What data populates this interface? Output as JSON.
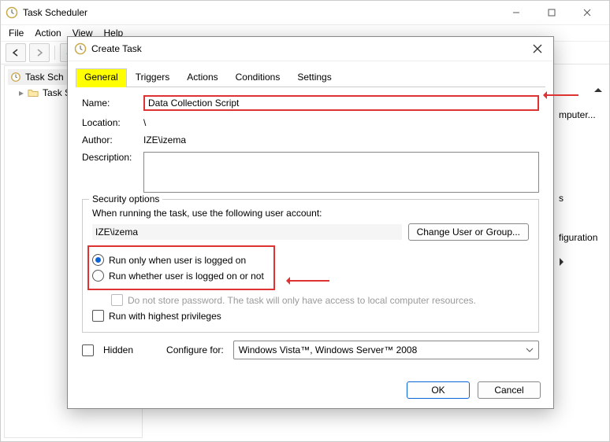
{
  "window": {
    "title": "Task Scheduler",
    "menus": [
      "File",
      "Action",
      "View",
      "Help"
    ]
  },
  "tree": {
    "root": "Task Scheduler",
    "child": "Task Scheduler Library",
    "root_short": "Task Sch",
    "child_short": "Task S"
  },
  "actions_pane": {
    "item_computer": "mputer...",
    "item_s": "s",
    "item_config": "figuration"
  },
  "dialog": {
    "title": "Create Task",
    "tabs": [
      "General",
      "Triggers",
      "Actions",
      "Conditions",
      "Settings"
    ],
    "labels": {
      "name": "Name:",
      "location": "Location:",
      "author": "Author:",
      "description": "Description:"
    },
    "values": {
      "name": "Data Collection Script",
      "location": "\\",
      "author": "IZE\\izema"
    },
    "security": {
      "legend": "Security options",
      "prompt": "When running the task, use the following user account:",
      "account": "IZE\\izema",
      "change_btn": "Change User or Group...",
      "radio_logged_on": "Run only when user is logged on",
      "radio_whether": "Run whether user is logged on or not",
      "no_store_pw": "Do not store password.  The task will only have access to local computer resources.",
      "highest_priv": "Run with highest privileges"
    },
    "hidden_label": "Hidden",
    "configure_label": "Configure for:",
    "configure_value": "Windows Vista™, Windows Server™ 2008",
    "ok": "OK",
    "cancel": "Cancel"
  }
}
